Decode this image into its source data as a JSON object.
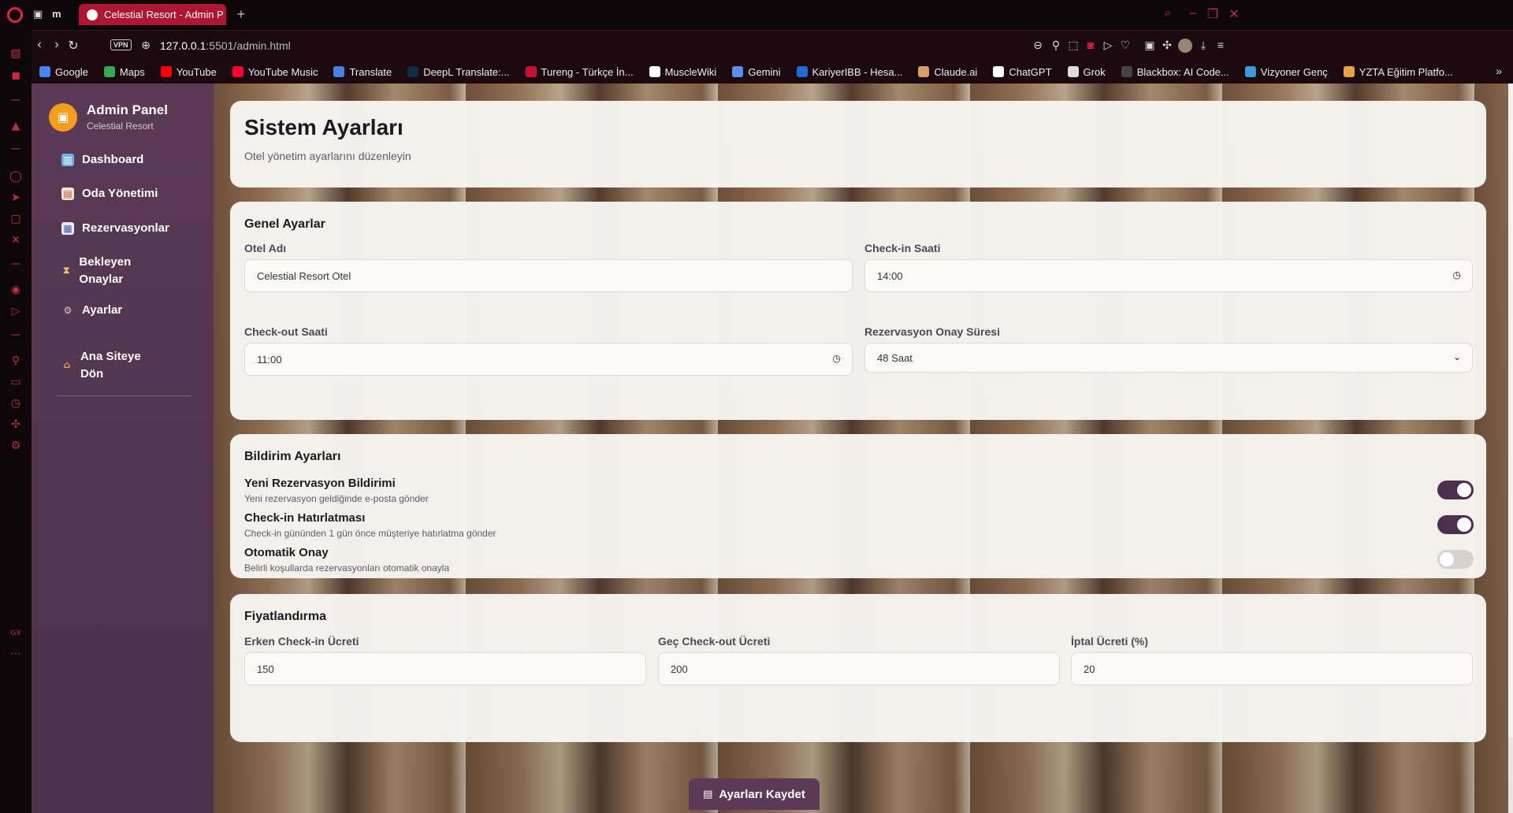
{
  "browser": {
    "tab_title": "Celestial Resort - Admin P",
    "new_tab": "+",
    "tab_icon_m": "m",
    "vpn": "VPN",
    "url_host": "127.0.0.1",
    "url_path": ":5501/admin.html",
    "bookmarks": [
      {
        "label": "Google",
        "color": "#4285f4"
      },
      {
        "label": "Maps",
        "color": "#34a853"
      },
      {
        "label": "YouTube",
        "color": "#ff0000"
      },
      {
        "label": "YouTube Music",
        "color": "#ff0033"
      },
      {
        "label": "Translate",
        "color": "#4a7fe0"
      },
      {
        "label": "DeepL Translate:...",
        "color": "#0f2b46"
      },
      {
        "label": "Tureng - Türkçe İn...",
        "color": "#c8102e"
      },
      {
        "label": "MuscleWiki",
        "color": "#ffffff"
      },
      {
        "label": "Gemini",
        "color": "#5b8def"
      },
      {
        "label": "KariyerIBB - Hesa...",
        "color": "#1e6bd6"
      },
      {
        "label": "Claude.ai",
        "color": "#d9a066"
      },
      {
        "label": "ChatGPT",
        "color": "#ffffff"
      },
      {
        "label": "Grok",
        "color": "#dddddd"
      },
      {
        "label": "Blackbox: AI Code...",
        "color": "#444444"
      },
      {
        "label": "Vizyoner Genç",
        "color": "#3a9bd8"
      },
      {
        "label": "YZTA Eğitim Platfo...",
        "color": "#e8a33d"
      }
    ],
    "bookmarks_more": "»"
  },
  "sidebar": {
    "brand_title": "Admin Panel",
    "brand_subtitle": "Celestial Resort",
    "items": [
      {
        "label": "Dashboard",
        "icon": "chart-icon"
      },
      {
        "label": "Oda Yönetimi",
        "icon": "calendar-icon"
      },
      {
        "label": "Rezervasyonlar",
        "icon": "calendar-grid-icon"
      },
      {
        "label": "Bekleyen Onaylar",
        "icon": "hourglass-icon"
      },
      {
        "label": "Ayarlar",
        "icon": "gear-icon"
      },
      {
        "label": "Ana Siteye Dön",
        "icon": "home-icon"
      }
    ]
  },
  "header": {
    "title": "Sistem Ayarları",
    "subtitle": "Otel yönetim ayarlarını düzenleyin"
  },
  "general": {
    "title": "Genel Ayarlar",
    "hotel_name_label": "Otel Adı",
    "hotel_name_value": "Celestial Resort Otel",
    "checkin_label": "Check-in Saati",
    "checkin_value": "14:00",
    "checkout_label": "Check-out Saati",
    "checkout_value": "11:00",
    "approval_label": "Rezervasyon Onay Süresi",
    "approval_value": "48 Saat"
  },
  "notifications": {
    "title": "Bildirim Ayarları",
    "items": [
      {
        "title": "Yeni Rezervasyon Bildirimi",
        "desc": "Yeni rezervasyon geldiğinde e-posta gönder",
        "enabled": true
      },
      {
        "title": "Check-in Hatırlatması",
        "desc": "Check-in gününden 1 gün önce müşteriye hatırlatma gönder",
        "enabled": true
      },
      {
        "title": "Otomatik Onay",
        "desc": "Belirli koşullarda rezervasyonları otomatik onayla",
        "enabled": false
      }
    ]
  },
  "pricing": {
    "title": "Fiyatlandırma",
    "early_label": "Erken Check-in Ücreti",
    "early_value": "150",
    "late_label": "Geç Check-out Ücreti",
    "late_value": "200",
    "cancel_label": "İptal Ücreti (%)",
    "cancel_value": "20"
  },
  "save_label": "Ayarları Kaydet",
  "colors": {
    "sidebar": "#5a3a55",
    "accent": "#4c2f4e",
    "browser_tab": "#b0162f"
  }
}
